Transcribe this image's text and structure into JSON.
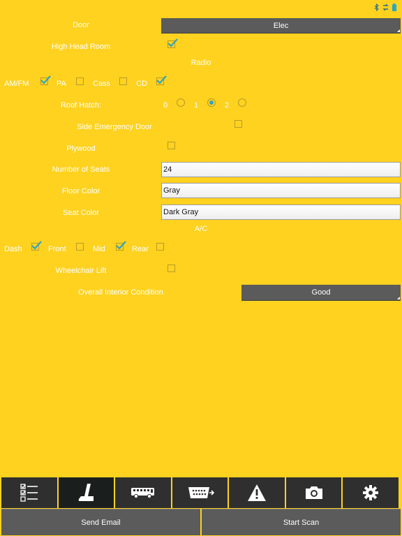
{
  "status_icons": [
    "bluetooth-icon",
    "data-transfer-icon",
    "battery-icon"
  ],
  "form": {
    "door": {
      "label": "Door",
      "value": "Elec"
    },
    "high_head_room": {
      "label": "High Head Room",
      "checked": true
    },
    "radio": {
      "heading": "Radio",
      "options": [
        {
          "label": "AM/FM",
          "checked": true
        },
        {
          "label": "PA",
          "checked": false
        },
        {
          "label": "Cass",
          "checked": false
        },
        {
          "label": "CD",
          "checked": true
        }
      ]
    },
    "roof_hatch": {
      "label": "Roof Hatch:",
      "options": [
        {
          "label": "0",
          "selected": false
        },
        {
          "label": "1",
          "selected": true
        },
        {
          "label": "2",
          "selected": false
        }
      ]
    },
    "side_emergency_door": {
      "label": "Side Emergency Door",
      "checked": false
    },
    "plywood": {
      "label": "Plywood",
      "checked": false
    },
    "number_of_seats": {
      "label": "Number of Seats",
      "value": "24"
    },
    "floor_color": {
      "label": "Floor Color",
      "value": "Gray"
    },
    "seat_color": {
      "label": "Seat Color",
      "value": "Dark Gray"
    },
    "ac": {
      "heading": "A/C",
      "options": [
        {
          "label": "Dash",
          "checked": true
        },
        {
          "label": "Front",
          "checked": false
        },
        {
          "label": "Mid",
          "checked": true
        },
        {
          "label": "Rear",
          "checked": false
        }
      ]
    },
    "wheelchair_lift": {
      "label": "Wheelchair Lift",
      "checked": false
    },
    "overall_interior_condition": {
      "label": "Overall Interior Condition",
      "value": "Good"
    }
  },
  "nav": [
    {
      "icon": "checklist-icon",
      "active": false
    },
    {
      "icon": "seat-icon",
      "active": true
    },
    {
      "icon": "bus-icon",
      "active": false
    },
    {
      "icon": "obd-connector-icon",
      "active": false
    },
    {
      "icon": "warning-icon",
      "active": false
    },
    {
      "icon": "camera-icon",
      "active": false
    },
    {
      "icon": "gear-icon",
      "active": false
    }
  ],
  "actions": {
    "send_email": "Send Email",
    "start_scan": "Start Scan"
  },
  "colors": {
    "background": "#FFD21F",
    "dark_button": "#5b5b5b",
    "nav_bg": "#2f2f2f",
    "check_accent": "#2aa6c4"
  }
}
